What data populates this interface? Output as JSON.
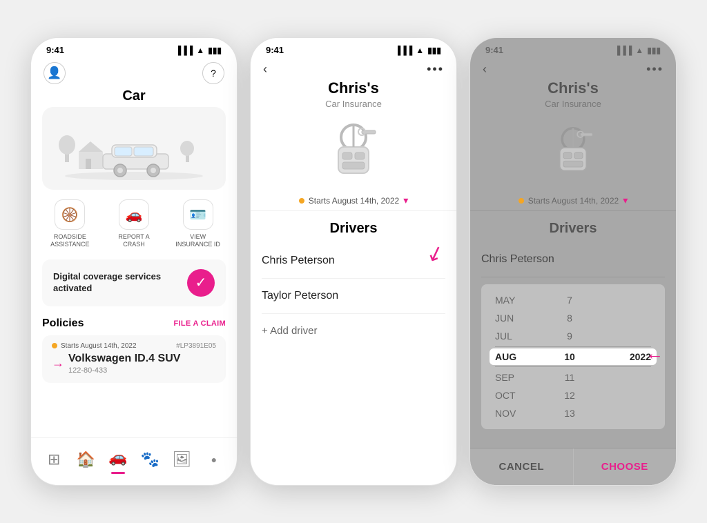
{
  "phone1": {
    "status_time": "9:41",
    "title": "Car",
    "quick_actions": [
      {
        "id": "roadside",
        "icon": "🛞",
        "label": "ROADSIDE\nASSISTANCE"
      },
      {
        "id": "crash",
        "icon": "💥",
        "label": "REPORT A\nCRASH"
      },
      {
        "id": "insurance",
        "icon": "🪪",
        "label": "VIEW\nINSURANCE ID"
      }
    ],
    "digital_coverage": "Digital coverage services activated",
    "policies_title": "Policies",
    "file_claim": "FILE A CLAIM",
    "policy_date": "Starts August 14th, 2022",
    "policy_number": "#LP3891E05",
    "policy_name": "Volkswagen ID.4 SUV",
    "policy_vin": "122-80-433",
    "nav_items": [
      "qr",
      "home",
      "car",
      "paw",
      "photo"
    ]
  },
  "phone2": {
    "status_time": "9:41",
    "title": "Chris's",
    "subtitle": "Car Insurance",
    "starts_date": "Starts August 14th, 2022",
    "drivers_title": "Drivers",
    "drivers": [
      "Chris Peterson",
      "Taylor Peterson"
    ],
    "add_driver": "+ Add driver"
  },
  "phone3": {
    "status_time": "9:41",
    "title": "Chris's",
    "subtitle": "Car Insurance",
    "starts_date": "Starts August 14th, 2022",
    "drivers_title": "Drivers",
    "driver": "Chris Peterson",
    "date_rows": [
      {
        "month": "MAY",
        "day": "7",
        "year": ""
      },
      {
        "month": "JUN",
        "day": "8",
        "year": ""
      },
      {
        "month": "JUL",
        "day": "9",
        "year": ""
      },
      {
        "month": "AUG",
        "day": "10",
        "year": "2022",
        "selected": true
      },
      {
        "month": "SEP",
        "day": "11",
        "year": ""
      },
      {
        "month": "OCT",
        "day": "12",
        "year": ""
      },
      {
        "month": "NOV",
        "day": "13",
        "year": ""
      }
    ],
    "cancel_label": "CANCEL",
    "choose_label": "CHOOSE"
  }
}
